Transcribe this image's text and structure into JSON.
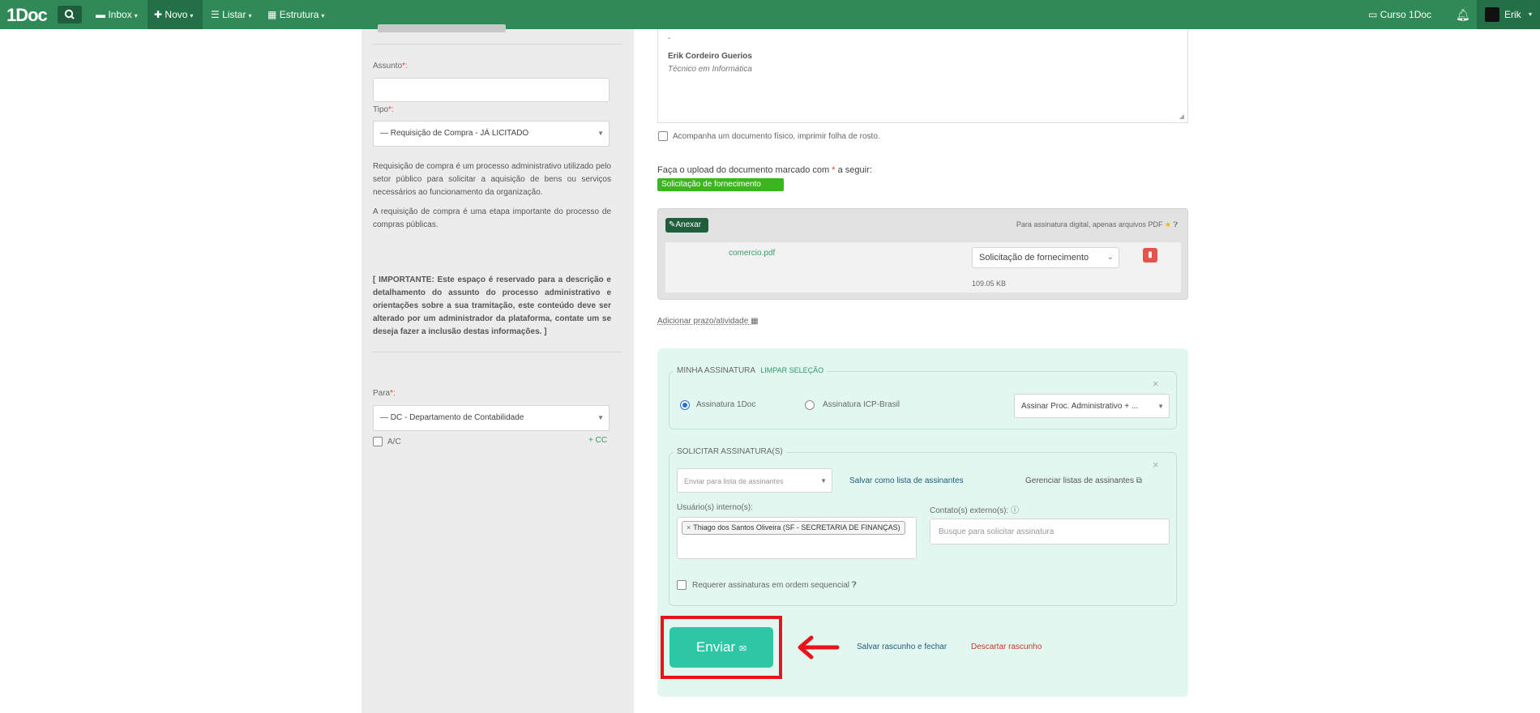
{
  "nav": {
    "logo": "1Doc",
    "inbox": "Inbox",
    "novo": "Novo",
    "listar": "Listar",
    "estrutura": "Estrutura",
    "curso": "Curso 1Doc",
    "user": "Erik"
  },
  "left": {
    "assunto_label": "Assunto",
    "required_mark": "*:",
    "tipo_label": "Tipo",
    "tipo_value": "— Requisição de Compra - JÁ LICITADO",
    "desc1": "Requisição de compra é um processo administrativo utilizado pelo setor público para solicitar a aquisição de bens ou serviços necessários ao funcionamento da organização.",
    "desc2": "A requisição de compra é uma etapa importante do processo de compras públicas.",
    "important": "[ IMPORTANTE: Este espaço é reservado para a descrição e detalhamento do assunto do processo administrativo e orientações sobre a sua tramitação, este conteúdo deve ser alterado por um administrador da plataforma, contate um se deseja fazer a inclusão destas informações. ]",
    "para_label": "Para",
    "para_value": "— DC - Departamento de Contabilidade",
    "ac_label": "A/C",
    "cc_link": "+ CC"
  },
  "editor": {
    "dash": "-",
    "signature_name": "Erik Cordeiro Guerios",
    "signature_role": "Técnico em Informática"
  },
  "main": {
    "physical_doc": "Acompanha um documento físico, imprimir folha de rosto.",
    "upload_prompt_before": "Faça o upload do documento marcado com",
    "upload_prompt_star": "*",
    "upload_prompt_after": "a seguir:",
    "upload_tag": "Solicitação de fornecimento",
    "anexar": "Anexar",
    "pdf_hint": "Para assinatura digital, apenas arquivos PDF",
    "file_name": "comercio.pdf",
    "file_type": "Solicitação de fornecimento",
    "file_size": "109.05 KB",
    "prazo_link": "Adicionar prazo/atividade"
  },
  "signature": {
    "minha_legend": "MINHA ASSINATURA",
    "limpar": "LIMPAR SELEÇÃO",
    "opt_1doc": "Assinatura 1Doc",
    "opt_icp": "Assinatura ICP-Brasil",
    "sign_mode": "Assinar Proc. Administrativo + ...",
    "solicitar_legend": "SOLICITAR ASSINATURA(S)",
    "list_placeholder": "Enviar para lista de assinantes",
    "salvar_lista": "Salvar como lista de assinantes",
    "gerenciar": "Gerenciar listas de assinantes",
    "internos_label": "Usuário(s) interno(s):",
    "externos_label": "Contato(s) externo(s):",
    "internal_user": "Thiago dos Santos Oliveira (SF - SECRETARIA DE FINANÇAS)",
    "external_placeholder": "Busque para solicitar assinatura",
    "sequencial": "Requerer assinaturas em ordem sequencial"
  },
  "actions": {
    "enviar": "Enviar",
    "salvar_rascunho": "Salvar rascunho e fechar",
    "descartar": "Descartar rascunho"
  },
  "colors": {
    "nav_bg": "#2f8a57",
    "enviar_bg": "#2ec7a6",
    "highlight": "#e8141c",
    "tag_green": "#3cb521"
  }
}
